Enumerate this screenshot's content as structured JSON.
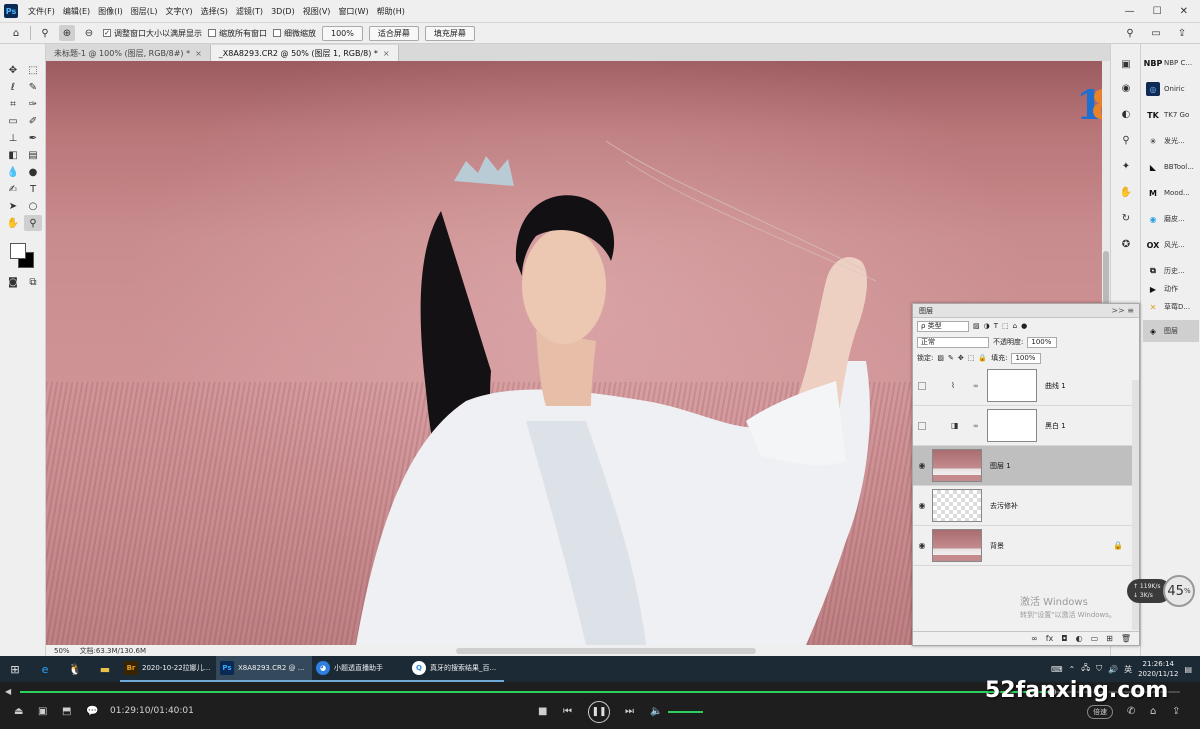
{
  "menubar": {
    "app_logo": "Ps",
    "items": [
      "文件(F)",
      "编辑(E)",
      "图像(I)",
      "图层(L)",
      "文字(Y)",
      "选择(S)",
      "滤镜(T)",
      "3D(D)",
      "视图(V)",
      "窗口(W)",
      "帮助(H)"
    ],
    "window_controls": [
      "—",
      "☐",
      "✕"
    ]
  },
  "options": {
    "resize_windows_label": "调整窗口大小以满屏显示",
    "zoom_all_label": "缩放所有窗口",
    "scrubby_zoom_label": "细微缩放",
    "zoom_value": "100%",
    "fit_screen_label": "适合屏幕",
    "fill_screen_label": "填充屏幕"
  },
  "tabs": [
    {
      "label": "未标题-1 @ 100% (图层, RGB/8#) *",
      "close": "×"
    },
    {
      "label": "_X8A8293.CR2 @ 50% (图层 1, RGB/8) *",
      "close": "×"
    }
  ],
  "status": {
    "zoom": "50%",
    "doc_size": "文档:63.3M/130.6M"
  },
  "plugins": [
    {
      "icon": "NBP",
      "label": "NBP C..."
    },
    {
      "icon": "◎",
      "label": "Oniric"
    },
    {
      "icon": "TK",
      "label": "TK7 Go"
    },
    {
      "icon": "✳",
      "label": "发光..."
    },
    {
      "icon": "◣",
      "label": "BBTool..."
    },
    {
      "icon": "M",
      "label": "Mood..."
    },
    {
      "icon": "◉",
      "label": "磨皮..."
    },
    {
      "icon": "OX",
      "label": "风光..."
    },
    {
      "icon": "⧉",
      "label": "历史..."
    },
    {
      "icon": "▶",
      "label": "动作"
    },
    {
      "icon": "✕",
      "label": "草莓D..."
    },
    {
      "icon": "◈",
      "label": "图层"
    }
  ],
  "layers_panel": {
    "title": "图层",
    "header_icons": ">>  ≡",
    "filter_kind": "ρ 类型",
    "blend_mode": "正常",
    "opacity_label": "不透明度:",
    "opacity_value": "100%",
    "lock_label": "锁定:",
    "fill_label": "填充:",
    "fill_value": "100%",
    "layers": [
      {
        "name": "曲线 1",
        "visible": false,
        "type": "adjustment"
      },
      {
        "name": "黑白 1",
        "visible": false,
        "type": "adjustment"
      },
      {
        "name": "图层 1",
        "visible": true,
        "type": "pixel",
        "selected": true
      },
      {
        "name": "去污修补",
        "visible": true,
        "type": "transparent"
      },
      {
        "name": "背景",
        "visible": true,
        "type": "background",
        "locked": true
      }
    ],
    "activation_title": "激活 Windows",
    "activation_sub": "转到\"设置\"以激活 Windows。",
    "footer_icons": [
      "∞",
      "fx",
      "◘",
      "◐",
      "▭",
      "⊞",
      "🗑"
    ]
  },
  "speed_widget": {
    "line1": "↑ 119K/s",
    "line2": "↓ 3K/s",
    "value": "45",
    "unit": "%"
  },
  "taskbar": {
    "apps": [
      {
        "icon": "Br",
        "label": "2020-10-22拉娜儿...",
        "color": "#e8a02a"
      },
      {
        "icon": "Ps",
        "label": "X8A8293.CR2 @ ...",
        "color": "#31a8ff"
      },
      {
        "icon": "◕",
        "label": "小题透直播助手",
        "color": "#2f7fe0"
      },
      {
        "icon": "Q",
        "label": "真牙的搜索结果_百...",
        "color": "#2b8ce0"
      }
    ],
    "time": "21:26:14",
    "date": "2020/11/12"
  },
  "player": {
    "time": "01:29:10/01:40:01",
    "progress": 0.89,
    "volume": 0.7,
    "speed_label": "倍速",
    "watermark": "52fanxing.com"
  }
}
